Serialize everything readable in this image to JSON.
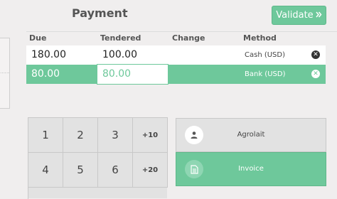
{
  "header": {
    "title": "Payment",
    "validate_label": "Validate",
    "validate_icon": "double-chevron-right-icon"
  },
  "table": {
    "columns": [
      "Due",
      "Tendered",
      "Change",
      "Method"
    ],
    "rows": [
      {
        "due": "180.00",
        "tendered": "100.00",
        "change": "",
        "method": "Cash (USD)",
        "selected": false
      },
      {
        "due": "80.00",
        "tendered": "80.00",
        "change": "",
        "method": "Bank (USD)",
        "selected": true
      }
    ]
  },
  "numpad": {
    "keys": [
      "1",
      "2",
      "3",
      "+10",
      "4",
      "5",
      "6",
      "+20"
    ]
  },
  "customer": {
    "label": "Agrolait",
    "icon": "user-icon"
  },
  "invoice": {
    "label": "Invoice",
    "icon": "document-icon"
  },
  "colors": {
    "accent": "#6ec89b"
  }
}
